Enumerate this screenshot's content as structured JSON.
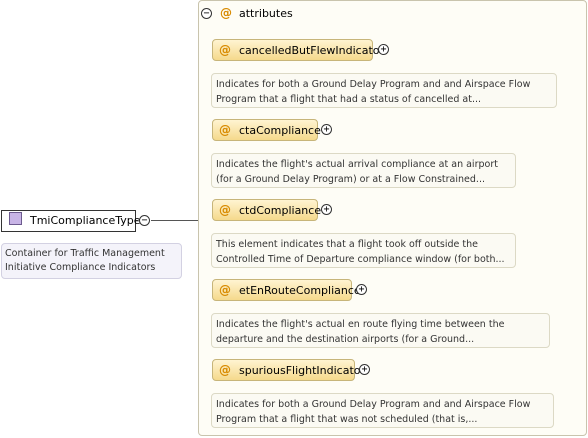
{
  "type_node": {
    "label": "TmiComplianceType",
    "documentation": [
      "Container for Traffic Management",
      "Initiative Compliance Indicators"
    ]
  },
  "group": {
    "title": "attributes",
    "collapse_symbol": "−",
    "at_symbol": "@"
  },
  "attributes": [
    {
      "name": "cancelledButFlewIndicator",
      "expand_symbol": "+",
      "doc": [
        "Indicates for both a Ground Delay Program and and Airspace Flow",
        "Program that a flight that had a status of cancelled at..."
      ]
    },
    {
      "name": "ctaCompliance",
      "expand_symbol": "+",
      "doc": [
        "Indicates the flight's actual arrival compliance at an airport",
        "(for a Ground Delay Program) or at a Flow Constrained..."
      ]
    },
    {
      "name": "ctdCompliance",
      "expand_symbol": "+",
      "doc": [
        "This element indicates that a flight took off outside the",
        "Controlled Time of Departure compliance window (for both..."
      ]
    },
    {
      "name": "etEnRouteCompliance",
      "expand_symbol": "+",
      "doc": [
        "Indicates the flight's actual en route flying time between the",
        "departure and the destination airports (for a Ground..."
      ]
    },
    {
      "name": "spuriousFlightIndicator",
      "expand_symbol": "+",
      "doc": [
        "Indicates for both a Ground Delay Program and and Airspace Flow",
        "Program that a flight that was not scheduled (that is,..."
      ]
    }
  ],
  "type_collapse_symbol": "−"
}
